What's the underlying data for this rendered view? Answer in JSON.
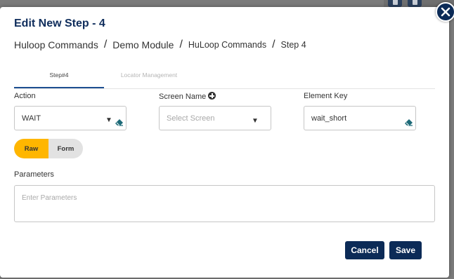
{
  "modal": {
    "title": "Edit New Step - 4"
  },
  "breadcrumb": [
    "Huloop Commands",
    "Demo Module",
    "HuLoop Commands",
    "Step 4"
  ],
  "breadcrumb_separator": "/",
  "tabs": [
    {
      "label": "Step#4",
      "active": true
    },
    {
      "label": "Locator Management",
      "active": false
    }
  ],
  "form": {
    "action": {
      "label": "Action",
      "value": "WAIT"
    },
    "screen_name": {
      "label": "Screen Name",
      "placeholder": "Select Screen"
    },
    "element_key": {
      "label": "Element Key",
      "value": "wait_short"
    },
    "mode_toggle": {
      "options": [
        "Raw",
        "Form"
      ],
      "selected": "Raw"
    },
    "parameters": {
      "label": "Parameters",
      "placeholder": "Enter Parameters"
    }
  },
  "buttons": {
    "cancel": "Cancel",
    "save": "Save"
  },
  "icons": {
    "close": "close-icon",
    "eraser": "eraser-icon",
    "plus": "plus-circle-icon",
    "caret": "chevron-down-icon"
  },
  "colors": {
    "primary": "#0c2b57",
    "title": "#0f2d5c",
    "toggle_active": "#ffb600",
    "eraser": "#1d6a78"
  }
}
